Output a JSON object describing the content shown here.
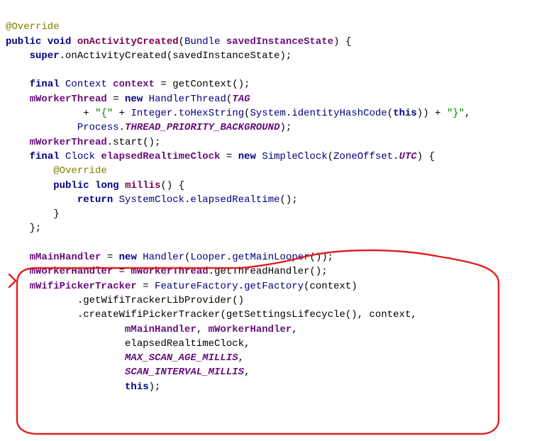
{
  "code": {
    "t_override": "@Override",
    "t_public": "public",
    "t_void": "void",
    "t_onActivityCreated": "onActivityCreated",
    "t_lparen": "(",
    "t_bundle_type": "Bundle",
    "t_space": " ",
    "t_savedInstanceState": "savedInstanceState",
    "t_rparen": ")",
    "t_lbrace": "{",
    "t_super": "super",
    "t_dot": ".",
    "t_onActivityCreated2": "onActivityCreated",
    "t_saved2": "savedInstanceState",
    "t_semi": ";",
    "t_final": "final",
    "t_Context": "Context",
    "t_context": "context",
    "t_eq": " = ",
    "t_getContext": "getContext",
    "t_empty_parens": "()",
    "t_mWorkerThread": "mWorkerThread",
    "t_new": "new",
    "t_HandlerThread": "HandlerThread",
    "t_TAG": "TAG",
    "t_plus": " + ",
    "t_open_curly_str": "\"{\"",
    "t_Integer": "Integer",
    "t_toHexString": "toHexString",
    "t_System": "System",
    "t_identityHashCode": "identityHashCode",
    "t_this": "this",
    "t_close_curly_str": "\"}\"",
    "t_comma": ",",
    "t_Process": "Process",
    "t_THREAD_PRIORITY_BACKGROUND": "THREAD_PRIORITY_BACKGROUND",
    "t_start": "start",
    "t_Clock": "Clock",
    "t_elapsedRealtimeClock": "elapsedRealtimeClock",
    "t_SimpleClock": "SimpleClock",
    "t_ZoneOffset": "ZoneOffset",
    "t_UTC": "UTC",
    "t_long": "long",
    "t_millis": "millis",
    "t_return": "return",
    "t_SystemClock": "SystemClock",
    "t_elapsedRealtime": "elapsedRealtime",
    "t_mMainHandler": "mMainHandler",
    "t_Handler": "Handler",
    "t_Looper": "Looper",
    "t_getMainLooper": "getMainLooper",
    "t_mWorkerHandler": "mWorkerHandler",
    "t_getThreadHandler": "getThreadHandler",
    "t_mWifiPickerTracker": "mWifiPickerTracker",
    "t_FeatureFactory": "FeatureFactory",
    "t_getFactory": "getFactory",
    "t_getWifiTrackerLibProvider": "getWifiTrackerLibProvider",
    "t_createWifiPickerTracker": "createWifiPickerTracker",
    "t_getSettingsLifecycle": "getSettingsLifecycle",
    "t_MAX_SCAN_AGE_MILLIS": "MAX_SCAN_AGE_MILLIS",
    "t_SCAN_INTERVAL_MILLIS": "SCAN_INTERVAL_MILLIS",
    "t_rbrace": "}"
  }
}
